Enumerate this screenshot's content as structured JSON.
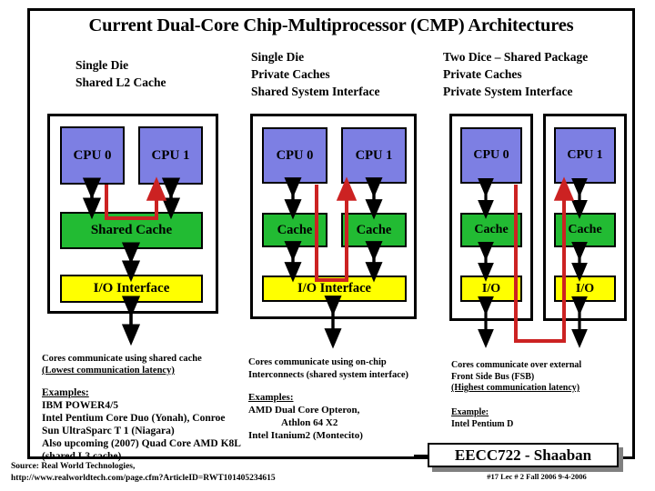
{
  "slide": {
    "title": "Current Dual-Core Chip-Multiprocessor (CMP) Architectures",
    "footer_source_line1": "Source: Real World Technologies,",
    "footer_source_line2": "http://www.realworldtech.com/page.cfm?ArticleID=RWT101405234615"
  },
  "colors": {
    "cpu_block": "#7d7fe3",
    "cache_block": "#22bb33",
    "io_block": "#ffff00",
    "arrow_black": "#000000",
    "arrow_red": "#cc2222",
    "border": "#000000",
    "page_background": "#ffffff"
  },
  "columns": [
    {
      "id": "shared-l2",
      "header_lines": [
        "Single Die",
        "Shared L2 Cache"
      ],
      "blocks": {
        "cpu0": "CPU 0",
        "cpu1": "CPU 1",
        "cache": "Shared Cache",
        "io": "I/O Interface"
      },
      "note_lines": [
        "Cores communicate using shared cache",
        "(Lowest communication latency)"
      ],
      "note_underlined_index": 1,
      "examples_label": "Examples:",
      "examples": [
        "IBM POWER4/5",
        "Intel Pentium Core Duo (Yonah), Conroe",
        "Sun UltraSparc T 1  (Niagara)",
        "Also upcoming  (2007) Quad Core AMD K8L",
        "(shared L3 cache)"
      ]
    },
    {
      "id": "private-caches-shared-interface",
      "header_lines": [
        "Single Die",
        "Private Caches",
        "Shared System Interface"
      ],
      "blocks": {
        "cpu0": "CPU 0",
        "cpu1": "CPU 1",
        "cache0": "Cache",
        "cache1": "Cache",
        "io": "I/O Interface"
      },
      "note_lines": [
        "Cores communicate using on-chip",
        "Interconnects (shared system interface)"
      ],
      "note_underlined_index": -1,
      "examples_label": "Examples:",
      "examples": [
        "AMD  Dual Core Opteron,",
        "Athlon 64 X2",
        "Intel Itanium2 (Montecito)"
      ],
      "examples_indent_index": 1
    },
    {
      "id": "two-dice-shared-package",
      "header_lines": [
        "Two Dice – Shared Package",
        "Private Caches",
        "Private System Interface"
      ],
      "blocks": {
        "cpu0": "CPU 0",
        "cpu1": "CPU 1",
        "cache0": "Cache",
        "cache1": "Cache",
        "io0": "I/O",
        "io1": "I/O"
      },
      "note_lines": [
        "Cores communicate over external",
        "Front Side Bus (FSB)",
        "(Highest communication latency)"
      ],
      "note_underlined_index": 2,
      "examples_label": "Example:",
      "examples": [
        "Intel Pentium D"
      ]
    }
  ],
  "signature": {
    "course": "EECC722 - Shaaban",
    "meta": "#17   Lec # 2   Fall 2006  9-4-2006"
  }
}
